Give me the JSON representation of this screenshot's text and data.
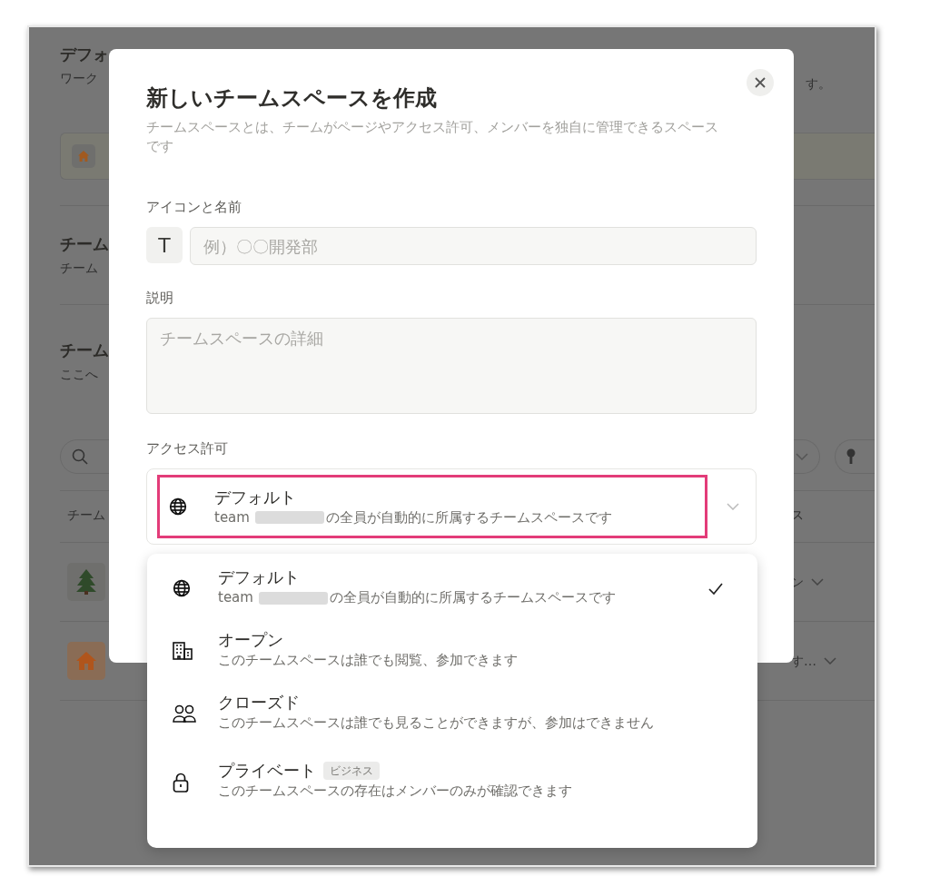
{
  "background": {
    "section_1": {
      "title": "デフォ",
      "subtitle": "ワーク",
      "subtitle_tail": "す。"
    },
    "section_2": {
      "title": "チーム",
      "subtitle": "チーム"
    },
    "section_3": {
      "title": "チーム",
      "subtitle": "ここへ"
    },
    "table": {
      "header_left": "チーム",
      "header_right": "ス",
      "rows": [
        {
          "kind": "tree",
          "access": "ン"
        },
        {
          "kind": "house",
          "access": "す…"
        }
      ]
    }
  },
  "modal": {
    "title": "新しいチームスペースを作成",
    "description": "チームスペースとは、チームがページやアクセス許可、メンバーを独自に管理できるスペースです",
    "name_label": "アイコンと名前",
    "icon_letter": "T",
    "name_placeholder": "例）〇〇開発部",
    "description_label": "説明",
    "description_placeholder": "チームスペースの詳細",
    "access_label": "アクセス許可",
    "access_current": {
      "kind": "default",
      "title": "デフォルト",
      "description_prefix": "team",
      "redacted": true,
      "description": "の全員が自動的に所属するチームスペースです",
      "highlighted": true
    }
  },
  "dropdown": {
    "options": [
      {
        "kind": "default",
        "title": "デフォルト",
        "description_prefix": "team",
        "redacted": true,
        "description": "の全員が自動的に所属するチームスペースです",
        "selected": true
      },
      {
        "kind": "open",
        "title": "オープン",
        "description": "このチームスペースは誰でも閲覧、参加できます",
        "selected": false
      },
      {
        "kind": "closed",
        "title": "クローズド",
        "description": "このチームスペースは誰でも見ることができますが、参加はできません",
        "selected": false
      },
      {
        "kind": "private",
        "title": "プライベート",
        "badge": "ビジネス",
        "description": "このチームスペースの存在はメンバーのみが確認できます",
        "selected": false
      }
    ]
  }
}
